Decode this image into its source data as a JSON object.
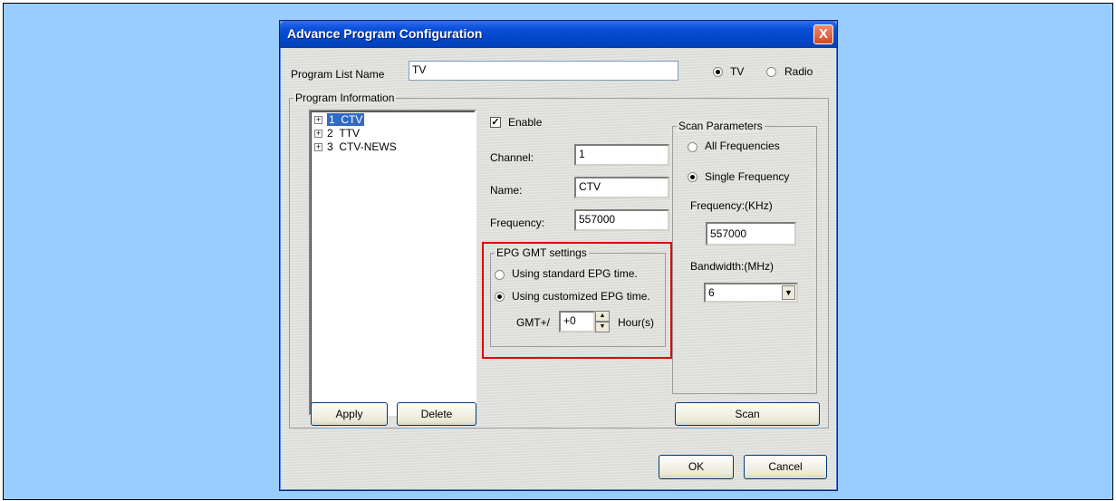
{
  "window": {
    "title": "Advance Program Configuration",
    "close_glyph": "X"
  },
  "program_list": {
    "label": "Program List Name",
    "value": "TV",
    "radio_tv": "TV",
    "radio_radio": "Radio",
    "selected": "TV"
  },
  "program_info": {
    "group_label": "Program Information",
    "tree": [
      {
        "number": "1",
        "name": "CTV",
        "selected": true
      },
      {
        "number": "2",
        "name": "TTV",
        "selected": false
      },
      {
        "number": "3",
        "name": "CTV-NEWS",
        "selected": false
      }
    ],
    "enable_label": "Enable",
    "enable_checked": true,
    "channel_label": "Channel:",
    "channel_value": "1",
    "name_label": "Name:",
    "name_value": "CTV",
    "frequency_label": "Frequency:",
    "frequency_value": "557000",
    "apply_label": "Apply",
    "delete_label": "Delete"
  },
  "epg": {
    "group_label": "EPG GMT settings",
    "standard_label": "Using standard EPG time.",
    "custom_label": "Using customized EPG time.",
    "selected": "custom",
    "gmt_label": "GMT+/",
    "gmt_value": "+0",
    "hours_label": "Hour(s)"
  },
  "scan": {
    "group_label": "Scan Parameters",
    "all_label": "All Frequencies",
    "single_label": "Single Frequency",
    "selected": "single",
    "frequency_label": "Frequency:(KHz)",
    "frequency_value": "557000",
    "bandwidth_label": "Bandwidth:(MHz)",
    "bandwidth_value": "6",
    "scan_button": "Scan"
  },
  "footer": {
    "ok_label": "OK",
    "cancel_label": "Cancel"
  },
  "colors": {
    "desktop": "#99ccff",
    "titlebar": "#0047c8",
    "highlight": "#e00000"
  }
}
